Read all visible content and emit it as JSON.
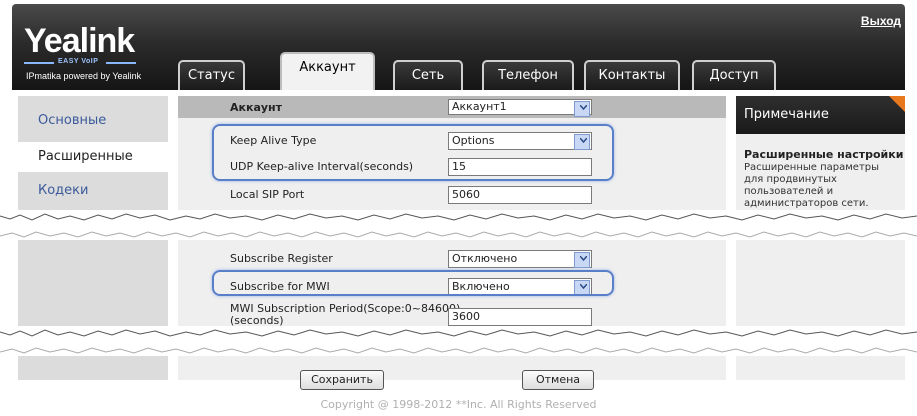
{
  "header": {
    "logo": "Yealink",
    "logo_sub": "EASY VoIP",
    "tagline": "IPmatika powered by Yealink",
    "logout": "Выход"
  },
  "tabs": [
    {
      "label": "Статус"
    },
    {
      "label": "Аккаунт"
    },
    {
      "label": "Сеть"
    },
    {
      "label": "Телефон"
    },
    {
      "label": "Контакты"
    },
    {
      "label": "Доступ"
    }
  ],
  "sidebar": {
    "items": [
      {
        "label": "Основные"
      },
      {
        "label": "Расширенные"
      },
      {
        "label": "Кодеки"
      }
    ]
  },
  "form": {
    "account_label": "Аккаунт",
    "account_value": "Аккаунт1",
    "keep_alive_type_label": "Keep Alive Type",
    "keep_alive_type_value": "Options",
    "udp_interval_label": "UDP Keep-alive Interval(seconds)",
    "udp_interval_value": "15",
    "local_sip_port_label": "Local SIP Port",
    "local_sip_port_value": "5060",
    "subscribe_register_label": "Subscribe Register",
    "subscribe_register_value": "Отключено",
    "subscribe_mwi_label": "Subscribe for MWI",
    "subscribe_mwi_value": "Включено",
    "mwi_period_label_1": "MWI Subscription Period(Scope:0~84600)",
    "mwi_period_label_2": "(seconds)",
    "mwi_period_value": "3600"
  },
  "note": {
    "header": "Примечание",
    "title": "Расширенные настройки",
    "text": "Расширенные параметры для продвинутых пользователей и администраторов сети."
  },
  "buttons": {
    "save": "Сохранить",
    "cancel": "Отмена"
  },
  "footer": {
    "copyright": "Copyright @ 1998-2012 **Inc. All Rights Reserved"
  },
  "colors": {
    "highlight": "#5a7fc9",
    "accent": "#e8781e",
    "link": "#3a5a9a"
  }
}
